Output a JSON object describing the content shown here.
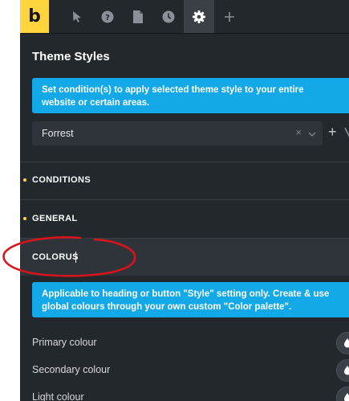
{
  "toolbar": {
    "logo": "b",
    "icons": [
      "pointer-icon",
      "help-icon",
      "page-icon",
      "history-icon",
      "gear-icon",
      "plus-icon"
    ]
  },
  "panel": {
    "title": "Theme Styles",
    "conditions_notice": "Set condition(s) to apply selected theme style to your entire website or certain areas.",
    "style_select": {
      "value": "Forrest",
      "clear": "×"
    },
    "add_button": "+"
  },
  "sections": [
    {
      "label": "CONDITIONS",
      "has_settings": true
    },
    {
      "label": "GENERAL",
      "has_settings": true
    },
    {
      "label": "COLORUS",
      "open": true
    }
  ],
  "colors_notice": "Applicable to heading or button \"Style\" setting only. Create & use global colours through your own custom \"Color palette\".",
  "colour_rows": [
    {
      "label": "Primary colour"
    },
    {
      "label": "Secondary colour"
    },
    {
      "label": "Light colour"
    }
  ],
  "colors": {
    "brand": "#ffd53e",
    "panel_bg": "#23282d",
    "notice_bg": "#13a8e8",
    "annotation": "#d8141b"
  }
}
